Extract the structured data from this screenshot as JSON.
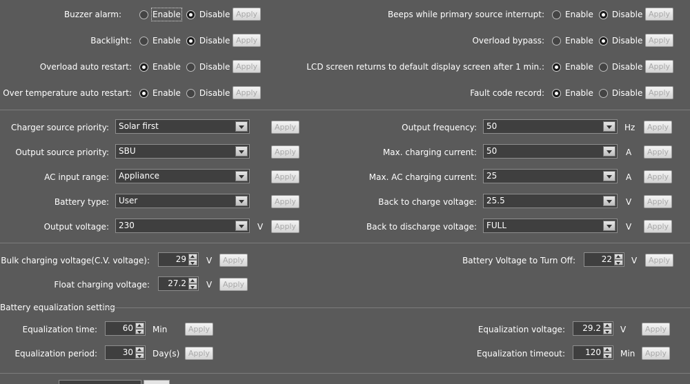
{
  "apply_label": "Apply",
  "radio_enable": "Enable",
  "radio_disable": "Disable",
  "radio_settings_left": [
    {
      "label": "Buzzer alarm:",
      "selected": "enable"
    },
    {
      "label": "Backlight:",
      "selected": "disable"
    },
    {
      "label": "Overload auto restart:",
      "selected": "enable"
    },
    {
      "label": "Over temperature auto restart:",
      "selected": "enable"
    }
  ],
  "radio_settings_right": [
    {
      "label": "Beeps while primary source interrupt:",
      "selected": "disable"
    },
    {
      "label": "Overload bypass:",
      "selected": "disable"
    },
    {
      "label": "LCD screen returns to default display screen after 1 min.:",
      "selected": "enable"
    },
    {
      "label": "Fault code record:",
      "selected": "enable"
    }
  ],
  "select_settings_left": [
    {
      "label": "Charger source priority:",
      "value": "Solar first",
      "unit": ""
    },
    {
      "label": "Output source priority:",
      "value": "SBU",
      "unit": ""
    },
    {
      "label": "AC input range:",
      "value": "Appliance",
      "unit": ""
    },
    {
      "label": "Battery type:",
      "value": "User",
      "unit": ""
    },
    {
      "label": "Output voltage:",
      "value": "230",
      "unit": "V"
    }
  ],
  "select_settings_right": [
    {
      "label": "Output frequency:",
      "value": "50",
      "unit": "Hz"
    },
    {
      "label": "Max. charging current:",
      "value": "50",
      "unit": "A"
    },
    {
      "label": "Max. AC charging current:",
      "value": "25",
      "unit": "A"
    },
    {
      "label": "Back to charge voltage:",
      "value": "25.5",
      "unit": "V"
    },
    {
      "label": "Back to discharge voltage:",
      "value": "FULL",
      "unit": "V"
    }
  ],
  "voltage_settings": {
    "bulk": {
      "label": "Bulk charging voltage(C.V. voltage):",
      "value": "29",
      "unit": "V"
    },
    "float": {
      "label": "Float charging voltage:",
      "value": "27.2",
      "unit": "V"
    },
    "turn_off": {
      "label": "Battery Voltage to Turn Off:",
      "value": "22",
      "unit": "V"
    }
  },
  "equalization": {
    "title": "Battery equalization setting",
    "time": {
      "label": "Equalization time:",
      "value": "60",
      "unit": "Min"
    },
    "period": {
      "label": "Equalization period:",
      "value": "30",
      "unit": "Day(s)"
    },
    "voltage": {
      "label": "Equalization voltage:",
      "value": "29.2",
      "unit": "V"
    },
    "timeout": {
      "label": "Equalization timeout:",
      "value": "120",
      "unit": "Min"
    }
  }
}
